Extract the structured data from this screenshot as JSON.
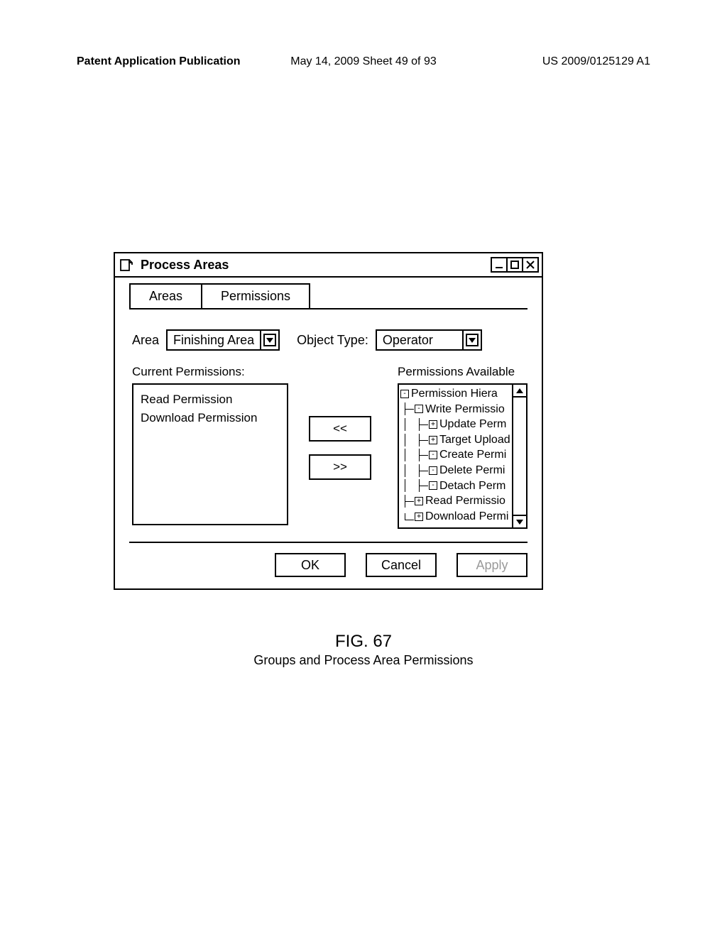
{
  "header": {
    "left": "Patent Application Publication",
    "mid": "May 14, 2009  Sheet 49 of 93",
    "right": "US 2009/0125129 A1"
  },
  "window": {
    "title": "Process Areas",
    "controls": {
      "min": "_",
      "max": "□",
      "close": "×"
    },
    "tabs": {
      "areas": "Areas",
      "permissions": "Permissions"
    },
    "fields": {
      "area_label": "Area",
      "area_value": "Finishing Area",
      "object_type_label": "Object Type:",
      "object_type_value": "Operator"
    },
    "current_permissions": {
      "label": "Current Permissions:",
      "items": [
        "Read Permission",
        "Download Permission"
      ]
    },
    "move_buttons": {
      "add": "<<",
      "remove": ">>"
    },
    "available": {
      "label": "Permissions Available",
      "tree": {
        "root": "Permission Hiera",
        "children": [
          {
            "label": "Write Permissio",
            "sym": "-",
            "children": [
              {
                "label": "Update Perm",
                "sym": "+"
              },
              {
                "label": "Target Upload",
                "sym": "+"
              },
              {
                "label": "Create Permi",
                "sym": "-"
              },
              {
                "label": "Delete Permi",
                "sym": "-"
              },
              {
                "label": "Detach Perm",
                "sym": "-"
              }
            ]
          },
          {
            "label": "Read Permissio",
            "sym": "+"
          },
          {
            "label": "Download Permi",
            "sym": "+"
          }
        ]
      }
    },
    "footer": {
      "ok": "OK",
      "cancel": "Cancel",
      "apply": "Apply"
    }
  },
  "figure": {
    "number": "FIG. 67",
    "title": "Groups and Process Area Permissions"
  }
}
